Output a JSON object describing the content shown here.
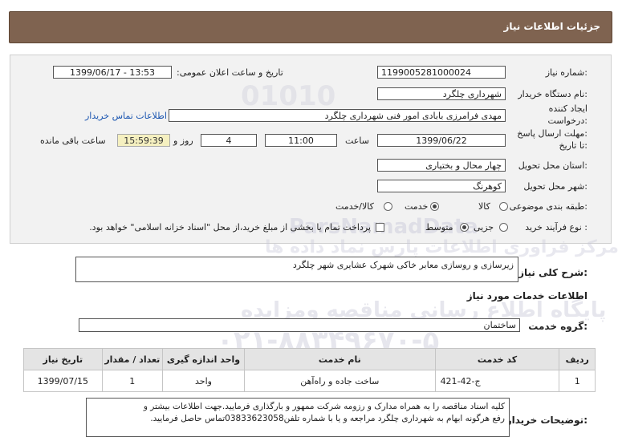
{
  "header": {
    "title": "جزئیات اطلاعات نیاز"
  },
  "fields": {
    "need_number_label": "شماره نیاز:",
    "need_number": "1199005281000024",
    "announce_label": "تاریخ و ساعت اعلان عمومی:",
    "announce_value": "1399/06/17 - 13:53",
    "buyer_label": "نام دستگاه خریدار:",
    "buyer_value": "شهرداری چلگرد",
    "creator_label_1": "ایجاد کننده",
    "creator_label_2": "درخواست:",
    "creator_value": "مهدی فرامرزی بابادی امور فنی شهرداری چلگرد",
    "contact_link": "اطلاعات تماس خریدار",
    "deadline_label_1": "مهلت ارسال پاسخ:",
    "deadline_label_2": "تا تاریخ:",
    "deadline_date": "1399/06/22",
    "time_label": "ساعت",
    "deadline_time": "11:00",
    "days_value": "4",
    "days_label": "روز و",
    "remaining_time": "15:59:39",
    "remaining_label": "ساعت باقی مانده",
    "province_label": "استان محل تحویل:",
    "province_value": "چهار محال و بختیاری",
    "city_label": "شهر محل تحویل:",
    "city_value": "کوهرنگ",
    "category_label": "طبقه بندی موضوعی:",
    "category_options": [
      "کالا",
      "خدمت",
      "کالا/خدمت"
    ],
    "category_selected": "خدمت",
    "process_label": "نوع فرآیند خرید :",
    "process_options": [
      "جزیی",
      "متوسط"
    ],
    "process_selected": "متوسط",
    "payment_note": "پرداخت تمام یا بخشی از مبلغ خرید،از محل \"اسناد خزانه اسلامی\" خواهد بود."
  },
  "summary": {
    "label": "شرح کلی نیاز:",
    "value": "زیرسازی و روسازی معابر خاکی شهرک عشایری شهر چلگرد"
  },
  "services": {
    "section_title": "اطلاعات خدمات مورد نیاز",
    "group_label": "گروه خدمت:",
    "group_value": "ساختمان",
    "columns": [
      "ردیف",
      "کد خدمت",
      "نام خدمت",
      "واحد اندازه گیری",
      "تعداد / مقدار",
      "تاریخ نیاز"
    ],
    "rows": [
      {
        "row": "1",
        "code": "ج-42-421",
        "name": "ساخت جاده و راه‌آهن",
        "unit": "واحد",
        "qty": "1",
        "date": "1399/07/15"
      }
    ]
  },
  "notes": {
    "label": "توضیحات خریدار:",
    "line1": "کلیه اسناد مناقصه را به همراه مدارک و رزومه شرکت ممهور و بارگذاری فرمایید.جهت اطلاعات بیشتر و",
    "line2": "رفع هرگونه ابهام به شهرداری چلگرد مراجعه و یا با شماره تلفن03833623058تماس حاصل فرمایید."
  },
  "watermark": {
    "brand": "ParsNamadData",
    "line1": "مرکز فراوری اطلاعات پارس نماد داده ها",
    "line2": "پایگاه اطلاع رسانی مناقصه ومزایده",
    "phone": "۰۲۱-۸۸۳۴۹۶۷۰-۵",
    "code": "01010"
  },
  "colors": {
    "header_bg": "#7f6350",
    "link": "#1a55b0",
    "timer_bg": "#f5f0c0"
  }
}
